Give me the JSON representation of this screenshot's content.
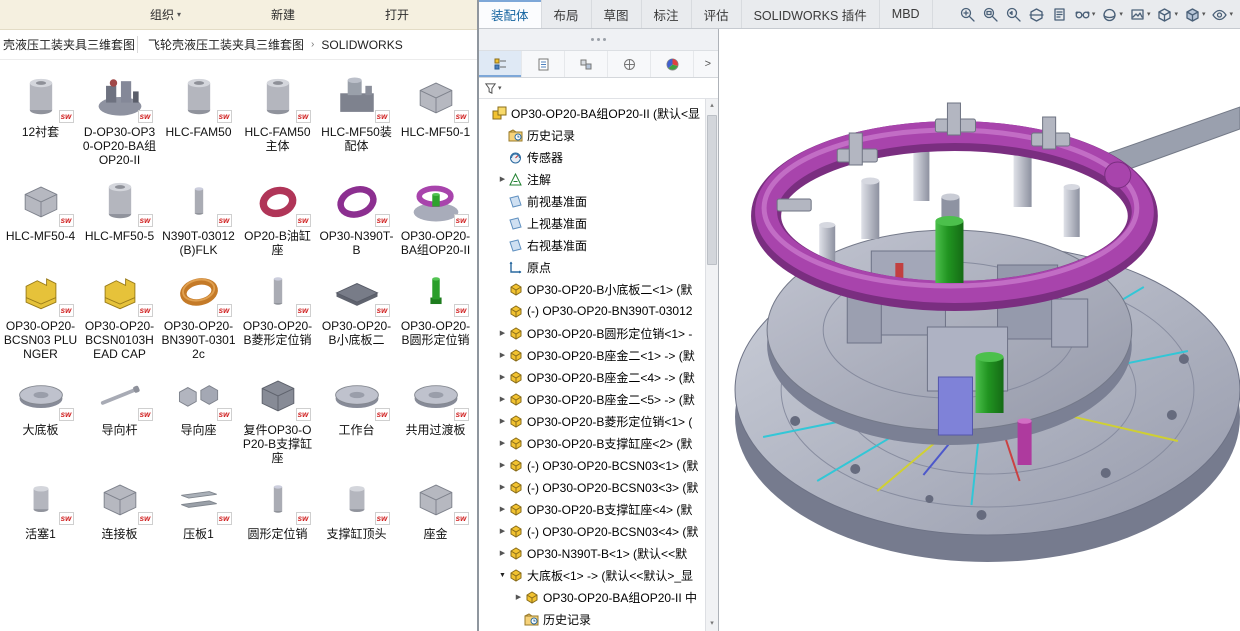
{
  "colors": {
    "ring_purple": "#a844ac",
    "clamp_green": "#2ea32e",
    "base_gray": "#aeb2c0",
    "magenta_cylinder": "#ad3a9d",
    "active_tab_text": "#1464a0",
    "explorer_toolbar_bg": "#f5f0e0"
  },
  "explorer": {
    "toolbar": {
      "organize": "组织",
      "new": "新建",
      "open": "打开"
    },
    "tab_title": "壳液压工装夹具三维套图",
    "breadcrumb": {
      "folder": "飞轮壳液压工装夹具三维套图",
      "separator": "›",
      "subfolder": "SOLIDWORKS"
    },
    "items": [
      {
        "label": "12衬套",
        "thumb": "cylinder"
      },
      {
        "label": "D-OP30-OP30-OP20-BA组OP20-II",
        "thumb": "assembly-dark"
      },
      {
        "label": "HLC-FAM50",
        "thumb": "cylinder"
      },
      {
        "label": "HLC-FAM50主体",
        "thumb": "cylinder"
      },
      {
        "label": "HLC-MF50装配体",
        "thumb": "machine"
      },
      {
        "label": "HLC-MF50-1",
        "thumb": "block"
      },
      {
        "label": "HLC-MF50-4",
        "thumb": "block"
      },
      {
        "label": "HLC-MF50-5",
        "thumb": "cylinder"
      },
      {
        "label": "N390T-03012(B)FLK",
        "thumb": "pin"
      },
      {
        "label": "OP20-B油缸座",
        "thumb": "ring-red"
      },
      {
        "label": "OP30-N390T-B",
        "thumb": "ring-purple"
      },
      {
        "label": "OP30-OP20-BA组OP20-II",
        "thumb": "assembly-color"
      },
      {
        "label": "OP30-OP20-BCSN03 PLUNGER",
        "thumb": "yellow-part"
      },
      {
        "label": "OP30-OP20-BCSN0103HEAD CAP",
        "thumb": "yellow-part"
      },
      {
        "label": "OP30-OP20-BN390T-03012c",
        "thumb": "ring-copper"
      },
      {
        "label": "OP30-OP20-B菱形定位销",
        "thumb": "pin"
      },
      {
        "label": "OP30-OP20-B小底板二",
        "thumb": "plate-dark"
      },
      {
        "label": "OP30-OP20-B圆形定位销",
        "thumb": "pin-green"
      },
      {
        "label": "大底板",
        "thumb": "disc"
      },
      {
        "label": "导向杆",
        "thumb": "rod"
      },
      {
        "label": "导向座",
        "thumb": "blocks"
      },
      {
        "label": "复件OP30-OP20-B支撑缸座",
        "thumb": "block-dark"
      },
      {
        "label": "工作台",
        "thumb": "disc"
      },
      {
        "label": "共用过渡板",
        "thumb": "disc"
      },
      {
        "label": "活塞1",
        "thumb": "cylinder-small"
      },
      {
        "label": "连接板",
        "thumb": "block"
      },
      {
        "label": "压板1",
        "thumb": "bars"
      },
      {
        "label": "圆形定位销",
        "thumb": "pin"
      },
      {
        "label": "支撑缸顶头",
        "thumb": "cylinder-small"
      },
      {
        "label": "座金",
        "thumb": "block"
      }
    ]
  },
  "solidworks": {
    "command_tabs": [
      {
        "name": "tab-assembly",
        "label": "装配体",
        "active": true
      },
      {
        "name": "tab-layout",
        "label": "布局"
      },
      {
        "name": "tab-sketch",
        "label": "草图"
      },
      {
        "name": "tab-annotate",
        "label": "标注"
      },
      {
        "name": "tab-evaluate",
        "label": "评估"
      },
      {
        "name": "tab-addins",
        "label": "SOLIDWORKS 插件"
      },
      {
        "name": "tab-mbd",
        "label": "MBD"
      }
    ],
    "headsup_icons": [
      {
        "name": "zoom-fit-icon"
      },
      {
        "name": "zoom-area-icon"
      },
      {
        "name": "zoom-previous-icon"
      },
      {
        "name": "section-view-icon"
      },
      {
        "name": "annotation-view-icon"
      },
      {
        "name": "hide-show-icon",
        "dropdown": true
      },
      {
        "name": "appearance-icon",
        "dropdown": true
      },
      {
        "name": "scene-icon",
        "dropdown": true
      },
      {
        "name": "view-orientation-icon",
        "dropdown": true
      },
      {
        "name": "display-style-icon",
        "dropdown": true
      },
      {
        "name": "visibility-options-icon",
        "dropdown": true
      }
    ],
    "panel_tabs": [
      {
        "name": "featuremanager-design-tree-tab",
        "active": true
      },
      {
        "name": "propertymanager-tab"
      },
      {
        "name": "configurationmanager-tab"
      },
      {
        "name": "dimxpertmanager-tab"
      },
      {
        "name": "displaymanager-tab"
      }
    ],
    "panel_tabs_overflow": ">",
    "tree": {
      "items": [
        {
          "indent": 0,
          "arrow": "none",
          "icon": "assembly",
          "label": "OP30-OP20-BA组OP20-II (默认<显"
        },
        {
          "indent": 1,
          "arrow": "none",
          "icon": "history",
          "label": "历史记录"
        },
        {
          "indent": 1,
          "arrow": "none",
          "icon": "sensor",
          "label": "传感器"
        },
        {
          "indent": 1,
          "arrow": "right",
          "icon": "annotation",
          "label": "注解"
        },
        {
          "indent": 1,
          "arrow": "none",
          "icon": "plane",
          "label": "前视基准面"
        },
        {
          "indent": 1,
          "arrow": "none",
          "icon": "plane",
          "label": "上视基准面"
        },
        {
          "indent": 1,
          "arrow": "none",
          "icon": "plane",
          "label": "右视基准面"
        },
        {
          "indent": 1,
          "arrow": "none",
          "icon": "origin",
          "label": "原点"
        },
        {
          "indent": 1,
          "arrow": "none",
          "icon": "part",
          "label": "OP30-OP20-B小底板二<1> (默"
        },
        {
          "indent": 1,
          "arrow": "none",
          "icon": "part",
          "label": "(-) OP30-OP20-BN390T-03012"
        },
        {
          "indent": 1,
          "arrow": "right",
          "icon": "part",
          "label": "OP30-OP20-B圆形定位销<1> -"
        },
        {
          "indent": 1,
          "arrow": "right",
          "icon": "part",
          "label": "OP30-OP20-B座金二<1> -> (默"
        },
        {
          "indent": 1,
          "arrow": "right",
          "icon": "part",
          "label": "OP30-OP20-B座金二<4> -> (默"
        },
        {
          "indent": 1,
          "arrow": "right",
          "icon": "part",
          "label": "OP30-OP20-B座金二<5> -> (默"
        },
        {
          "indent": 1,
          "arrow": "right",
          "icon": "part",
          "label": "OP30-OP20-B菱形定位销<1> ("
        },
        {
          "indent": 1,
          "arrow": "right",
          "icon": "part",
          "label": "OP30-OP20-B支撑缸座<2> (默"
        },
        {
          "indent": 1,
          "arrow": "right",
          "icon": "part",
          "label": "(-) OP30-OP20-BCSN03<1> (默"
        },
        {
          "indent": 1,
          "arrow": "right",
          "icon": "part",
          "label": "(-) OP30-OP20-BCSN03<3> (默"
        },
        {
          "indent": 1,
          "arrow": "right",
          "icon": "part",
          "label": "OP30-OP20-B支撑缸座<4> (默"
        },
        {
          "indent": 1,
          "arrow": "right",
          "icon": "part",
          "label": "(-) OP30-OP20-BCSN03<4> (默"
        },
        {
          "indent": 1,
          "arrow": "right",
          "icon": "part",
          "label": "OP30-N390T-B<1> (默认<<默"
        },
        {
          "indent": 1,
          "arrow": "down",
          "icon": "part",
          "label": "大底板<1> -> (默认<<默认>_显"
        },
        {
          "indent": 2,
          "arrow": "right",
          "icon": "part",
          "label": "OP30-OP20-BA组OP20-II 中"
        },
        {
          "indent": 2,
          "arrow": "none",
          "icon": "history",
          "label": "历史记录"
        }
      ]
    }
  }
}
